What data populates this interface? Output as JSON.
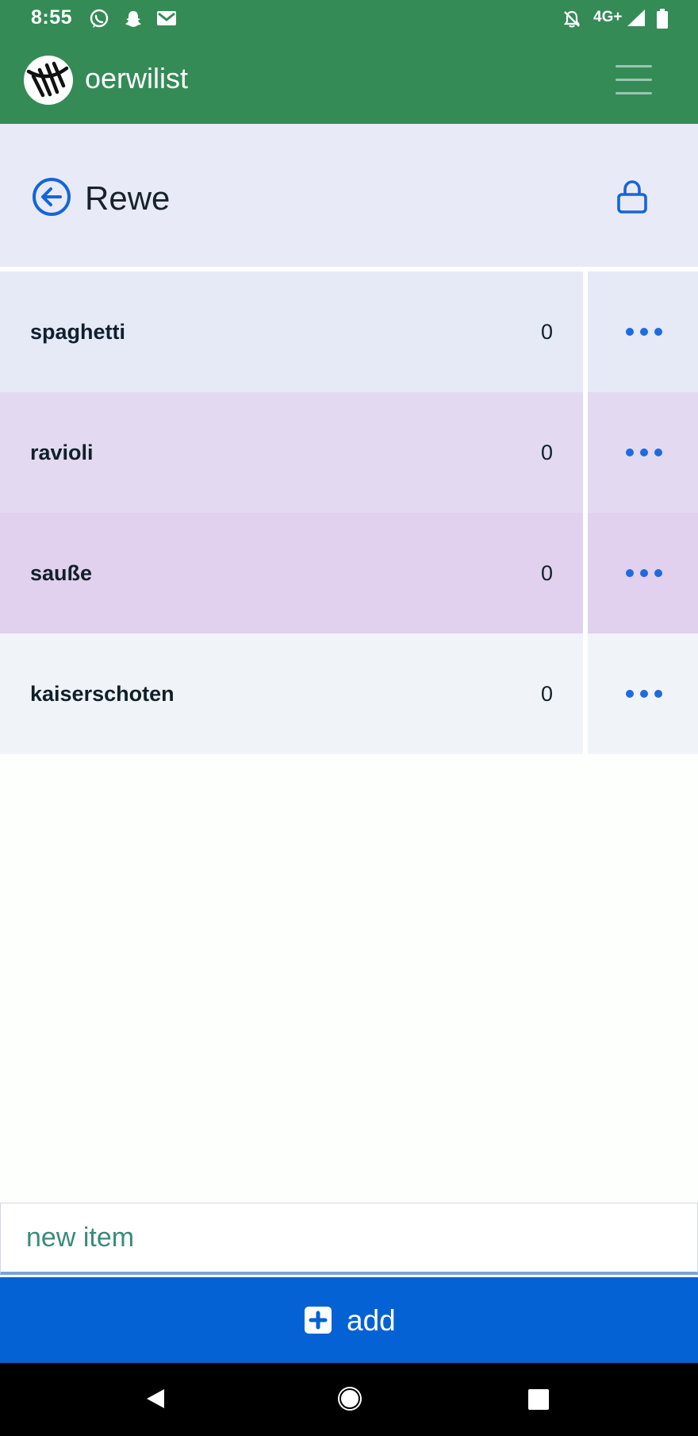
{
  "status_bar": {
    "time": "8:55",
    "network": "4G+",
    "icons": [
      "whatsapp-icon",
      "snapchat-icon",
      "gmail-icon",
      "bell-off-icon",
      "signal-icon",
      "battery-icon"
    ]
  },
  "app_bar": {
    "title": "oerwilist",
    "logo_icon": "tally-marks-logo",
    "menu_icon": "hamburger-menu-icon",
    "color": "#348b56"
  },
  "list": {
    "title": "Rewe",
    "back_icon": "circle-arrow-left-icon",
    "lock_icon": "lock-icon",
    "items": [
      {
        "name": "spaghetti",
        "quantity": "0",
        "bg": "#e6e9f6"
      },
      {
        "name": "ravioli",
        "quantity": "0",
        "bg": "#e3daf1"
      },
      {
        "name": "saußе",
        "quantity": "0",
        "bg": "#e1d1ee"
      },
      {
        "name": "kaiserschoten",
        "quantity": "0",
        "bg": "#f0f4f9"
      }
    ]
  },
  "input": {
    "placeholder": "new item",
    "value": ""
  },
  "add_button": {
    "label": "add",
    "icon": "plus-square-icon",
    "color": "#0462d4"
  },
  "nav_bar": {
    "icons": [
      "nav-back-icon",
      "nav-home-icon",
      "nav-recents-icon"
    ]
  }
}
